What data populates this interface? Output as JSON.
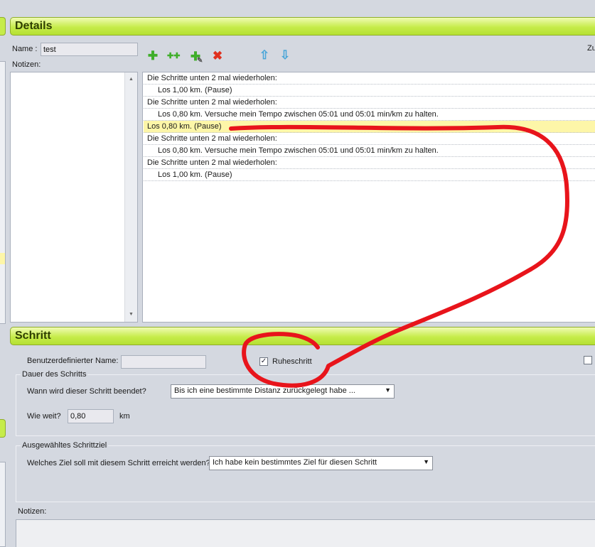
{
  "details": {
    "header": "Details",
    "name_label": "Name :",
    "name_value": "test",
    "notes_label": "Notizen:",
    "right_cut_label": "Zu",
    "toolbar": {
      "add_icon": "plus-green-icon",
      "add_repeat_icon": "double-plus-icon",
      "add_edit_icon": "plus-edit-icon",
      "delete_icon": "red-x-icon",
      "up_icon": "arrow-up-icon",
      "down_icon": "arrow-down-icon"
    },
    "steps": [
      {
        "text": "Die Schritte unten 2 mal wiederholen:",
        "indent": false,
        "selected": false
      },
      {
        "text": "Los 1,00 km.   (Pause)",
        "indent": true,
        "selected": false
      },
      {
        "text": "Die Schritte unten 2 mal wiederholen:",
        "indent": false,
        "selected": false
      },
      {
        "text": "Los 0,80 km.  Versuche mein Tempo zwischen 05:01 und 05:01 min/km zu halten.",
        "indent": true,
        "selected": false
      },
      {
        "text": "Los 0,80 km.   (Pause)",
        "indent": false,
        "selected": true
      },
      {
        "text": "Die Schritte unten 2 mal wiederholen:",
        "indent": false,
        "selected": false
      },
      {
        "text": "Los 0,80 km.  Versuche mein Tempo zwischen 05:01 und 05:01 min/km zu halten.",
        "indent": true,
        "selected": false
      },
      {
        "text": "Die Schritte unten 2 mal wiederholen:",
        "indent": false,
        "selected": false
      },
      {
        "text": "Los 1,00 km.   (Pause)",
        "indent": true,
        "selected": false
      }
    ]
  },
  "schritt": {
    "header": "Schritt",
    "custom_name_label": "Benutzerdefinierter Name:",
    "custom_name_value": "",
    "rest_step_label": "Ruheschritt",
    "rest_step_checked": true,
    "duration_group": "Dauer des Schritts",
    "when_label": "Wann wird dieser Schritt beendet?",
    "when_value": "Bis ich eine bestimmte Distanz zurückgelegt habe ...",
    "distance_label": "Wie weit?",
    "distance_value": "0,80",
    "distance_unit": "km",
    "target_group": "Ausgewähltes Schrittziel",
    "target_label": "Welches Ziel soll mit diesem Schritt erreicht werden?",
    "target_value": "Ich habe kein bestimmtes Ziel für diesen Schritt",
    "notes_label": "Notizen:"
  },
  "colors": {
    "header_green": "#c6ec4a",
    "selected_row": "#fdf6a8",
    "annotation_red": "#e8141b"
  }
}
